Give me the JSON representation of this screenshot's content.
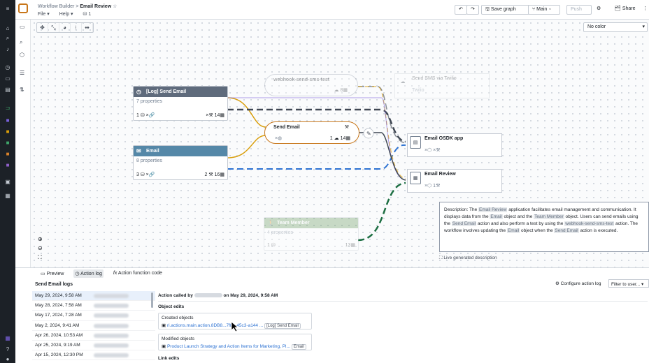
{
  "breadcrumb": {
    "parent": "Workflow Builder",
    "sep": ">",
    "current": "Email Review",
    "star": "☆"
  },
  "menus": [
    "File ▾",
    "Help ▾",
    "⛁ 1"
  ],
  "toolbar": {
    "undo": "↶",
    "redo": "↷",
    "save": "🖫 Save graph",
    "branch": "⑂ Main ▾",
    "push": "Push",
    "settings": "⚙",
    "share": "🗂 Share",
    "more": "⋮"
  },
  "color_select": "No color",
  "nodes": {
    "log_send_email": {
      "title": "[Log] Send Email",
      "props": "7 properties",
      "left": "1",
      "right": "14",
      "color": "#5f6b7c"
    },
    "email": {
      "title": "Email",
      "props": "8 properties",
      "left": "3",
      "mid": "2",
      "right": "16",
      "color": "#5588a8"
    },
    "team_member": {
      "title": "Team Member",
      "props": "4 properties",
      "left": "1",
      "right": "13",
      "color": "#6a9b62"
    },
    "send_email": {
      "title": "Send Email",
      "left": "1",
      "right": "14"
    },
    "webhook": {
      "title": "webhook-send-sms-test",
      "count": "8"
    },
    "send_sms": {
      "title": "Send SMS via Twilio",
      "sub": "Twilio"
    },
    "osdk": {
      "title": "Email OSDK app"
    },
    "email_review": {
      "title": "Email Review",
      "count": "1"
    }
  },
  "description": {
    "p1": "Description: The ",
    "app": "Email Review",
    "p2": " application facilitates email management and communication. It displays data from the ",
    "obj1": "Email",
    "p3": " object and the ",
    "obj2": "Team Member",
    "p4": " object. Users can send emails using the ",
    "act1": "Send Email",
    "p5": " action and also perform a test by using the ",
    "act2": "webhook-send-sms-test",
    "p6": " action. The workflow involves updating the ",
    "obj3": "Email",
    "p7": " object when the ",
    "act3": "Send Email",
    "p8": " action is executed.",
    "footer": "Live generated description"
  },
  "bottom": {
    "tabs": [
      "Preview",
      "Action log",
      "Action function code"
    ],
    "title": "Send Email logs",
    "configure": "Configure action log",
    "filter": "Filter to user...",
    "logs": [
      "May 29, 2024, 9:58 AM",
      "May 28, 2024, 7:58 AM",
      "May 17, 2024, 7:28 AM",
      "May 2, 2024, 9:41 AM",
      "Apr 26, 2024, 10:53 AM",
      "Apr 25, 2024, 9:19 AM",
      "Apr 15, 2024, 12:30 PM"
    ],
    "action_called_by": "Action called by",
    "action_on": "on May 29, 2024, 9:58 AM",
    "object_edits": "Object edits",
    "created": "Created objects",
    "created_link": "ri.actions.main.action.8DB8...7f8b-45c3-a144 ...",
    "created_tag": "[Log] Send Email",
    "modified": "Modified objects",
    "modified_link": "Product Launch Strategy and Action Items for Marketing, Pl...",
    "modified_tag": "Email",
    "link_edits": "Link edits"
  }
}
